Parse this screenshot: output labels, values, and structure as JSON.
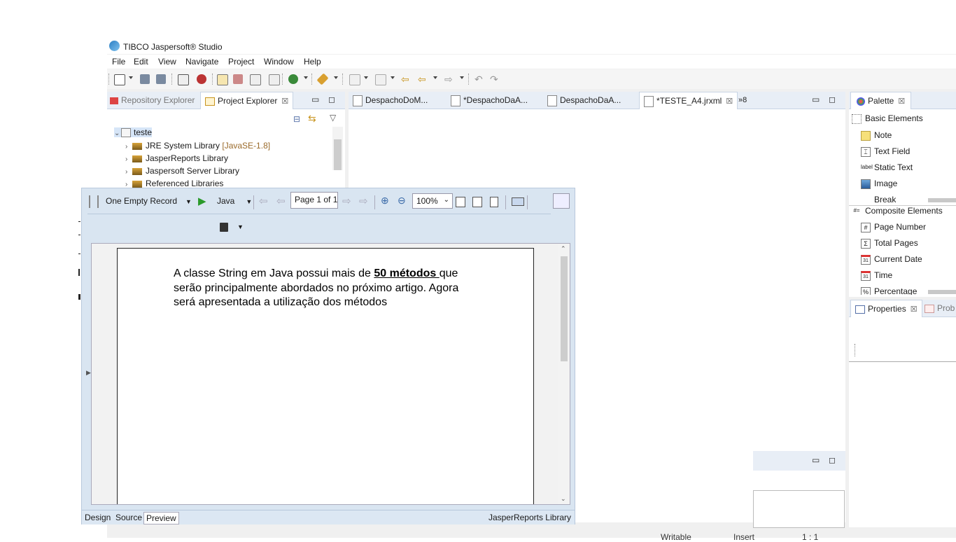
{
  "window": {
    "title": "TIBCO Jaspersoft® Studio"
  },
  "menu": [
    "File",
    "Edit",
    "View",
    "Navigate",
    "Project",
    "Window",
    "Help"
  ],
  "left_tabs": {
    "repo": "Repository Explorer",
    "project": "Project Explorer"
  },
  "tree": {
    "root": "teste",
    "items": [
      {
        "label": "JRE System Library",
        "deco": "[JavaSE-1.8]"
      },
      {
        "label": "JasperReports Library",
        "deco": ""
      },
      {
        "label": "Jaspersoft Server Library",
        "deco": ""
      },
      {
        "label": "Referenced Libraries",
        "deco": ""
      }
    ]
  },
  "editor_tabs": [
    "DespachoDoM...",
    "*DespachoDaA...",
    "DespachoDaA...",
    "*TESTE_A4.jrxml"
  ],
  "editor_overflow": "»8",
  "palette": {
    "tab": "Palette",
    "basic_title": "Basic Elements",
    "basic": [
      {
        "label": "Note",
        "icon": "note-icon"
      },
      {
        "label": "Text Field",
        "icon": "text-field-icon"
      },
      {
        "label": "Static Text",
        "icon": "static-text-icon"
      },
      {
        "label": "Image",
        "icon": "image-icon"
      },
      {
        "label": "Break",
        "icon": "break-icon"
      }
    ],
    "composite_title": "Composite Elements",
    "composite": [
      {
        "label": "Page Number",
        "icon": "hash-icon"
      },
      {
        "label": "Total Pages",
        "icon": "sigma-icon"
      },
      {
        "label": "Current Date",
        "icon": "calendar-icon"
      },
      {
        "label": "Time",
        "icon": "calendar-icon"
      },
      {
        "label": "Percentage",
        "icon": "percent-icon"
      }
    ]
  },
  "properties_tabs": {
    "properties": "Properties",
    "problems": "Prob"
  },
  "preview": {
    "datasource": "One Empty Record",
    "language": "Java",
    "page_indicator": "Page 1 of 1",
    "zoom": "100%",
    "report": {
      "text_before": "A classe String em Java possui mais de ",
      "bold": "50 métodos ",
      "text_after": "que serão principalmente abordados no próximo artigo. Agora será apresentada a utilização dos métodos"
    },
    "tabs": [
      "Design",
      "Source",
      "Preview"
    ],
    "active_tab": "Preview",
    "library_label": "JasperReports Library"
  },
  "status": {
    "writable": "Writable",
    "insert": "Insert",
    "position": "1 : 1"
  }
}
